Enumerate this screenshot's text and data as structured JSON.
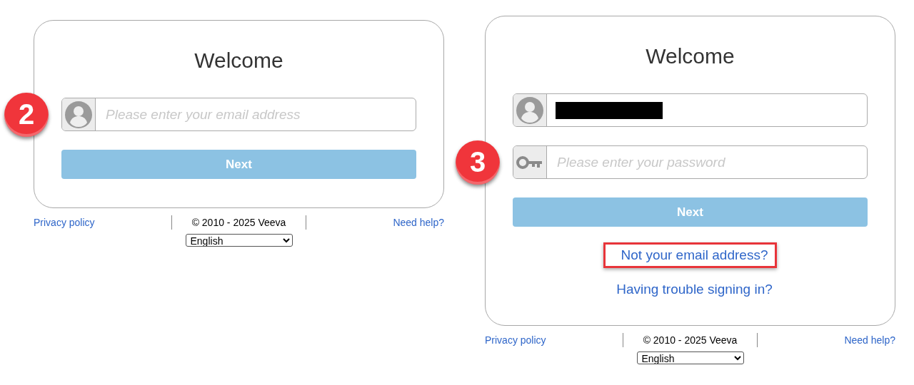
{
  "panels": [
    {
      "title": "Welcome",
      "fields": [
        {
          "kind": "email",
          "step": "2",
          "placeholder": "Please enter your email address"
        }
      ],
      "button": {
        "label": "Next",
        "disabled": true
      },
      "footer": {
        "privacy": "Privacy policy",
        "copyright": "© 2010 - 2025 Veeva",
        "help": "Need help?",
        "language": "English"
      }
    },
    {
      "title": "Welcome",
      "fields": [
        {
          "kind": "email",
          "redacted": true
        },
        {
          "kind": "password",
          "step": "3",
          "placeholder": "Please enter your password"
        }
      ],
      "button": {
        "label": "Next",
        "disabled": true
      },
      "links": [
        {
          "text": "Not your email address?",
          "highlighted": true
        },
        {
          "text": "Having trouble signing in?",
          "highlighted": false
        }
      ],
      "footer": {
        "privacy": "Privacy policy",
        "copyright": "© 2010 - 2025 Veeva",
        "help": "Need help?",
        "language": "English"
      }
    }
  ]
}
